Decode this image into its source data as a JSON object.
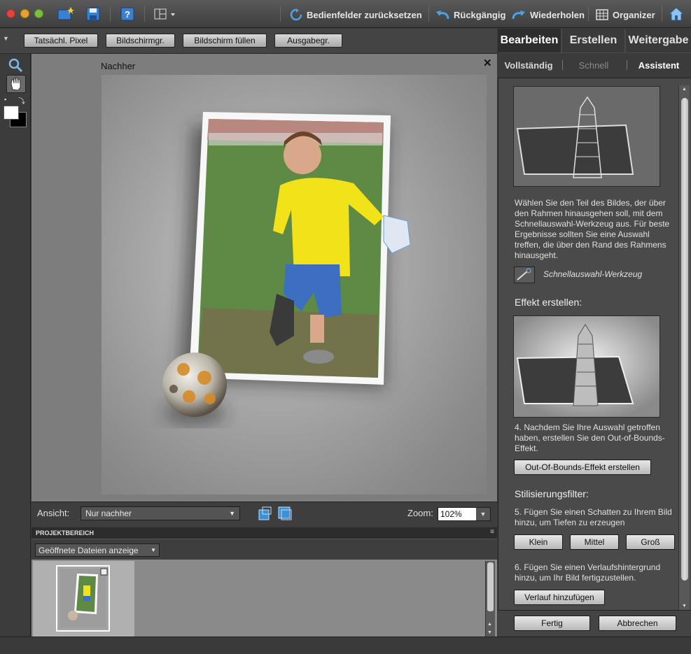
{
  "toolbar": {
    "reset_panels": "Bedienfelder zurücksetzen",
    "undo": "Rückgängig",
    "redo": "Wiederholen",
    "organizer": "Organizer"
  },
  "view_buttons": {
    "actual_pixels": "Tatsächl. Pixel",
    "screen_size": "Bildschirmgr.",
    "fill_screen": "Bildschirm füllen",
    "print_size": "Ausgabegr."
  },
  "canvas": {
    "title": "Nachher",
    "close": "✕"
  },
  "viewbar": {
    "label": "Ansicht:",
    "select_value": "Nur nachher",
    "zoom_label": "Zoom:",
    "zoom_value": "102%"
  },
  "project": {
    "header": "PROJEKTBEREICH",
    "dropdown": "Geöffnete Dateien anzeige"
  },
  "panel": {
    "main_tabs": [
      "Bearbeiten",
      "Erstellen",
      "Weitergabe"
    ],
    "sub_tabs": [
      "Vollständig",
      "Schnell",
      "Assistent"
    ],
    "step_text": "Wählen Sie den Teil des Bildes, der über den Rahmen hinausgehen soll, mit dem Schnellauswahl-Werkzeug aus. Für beste Ergebnisse sollten Sie eine Auswahl treffen, die über den Rand des Rahmens hinausgeht.",
    "tool_name": "Schnellauswahl-Werkzeug",
    "effect_heading": "Effekt erstellen:",
    "step4": "4. Nachdem Sie Ihre Auswahl getroffen haben, erstellen Sie den Out-of-Bounds-Effekt.",
    "create_btn": "Out-Of-Bounds-Effekt erstellen",
    "filter_heading": "Stilisierungsfilter:",
    "step5": "5. Fügen Sie einen Schatten zu Ihrem Bild hinzu, um Tiefen zu erzeugen",
    "shadow_small": "Klein",
    "shadow_medium": "Mittel",
    "shadow_large": "Groß",
    "step6": "6. Fügen Sie einen Verlaufshintergrund hinzu, um Ihr Bild fertigzustellen.",
    "gradient_btn": "Verlauf hinzufügen",
    "done_btn": "Fertig",
    "cancel_btn": "Abbrechen"
  }
}
